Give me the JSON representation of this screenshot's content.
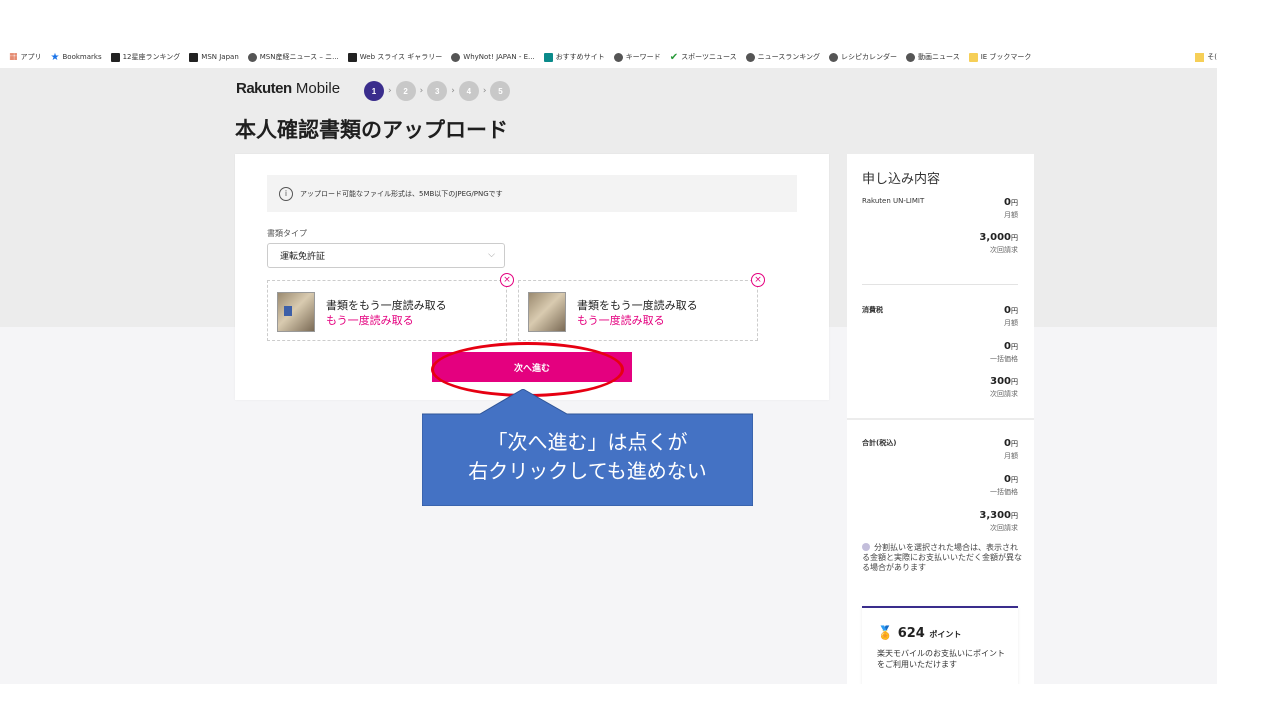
{
  "bookmarks": {
    "items": [
      {
        "label": "アプリ",
        "icon": "apps-icon"
      },
      {
        "label": "Bookmarks",
        "icon": "star-icon"
      },
      {
        "label": "12星座ランキング",
        "icon": "msn-icon"
      },
      {
        "label": "MSN Japan",
        "icon": "msn-icon"
      },
      {
        "label": "MSN産経ニュース – ニ...",
        "icon": "globe-icon"
      },
      {
        "label": "Web スライス ギャラリー",
        "icon": "msn-icon"
      },
      {
        "label": "WhyNot! JAPAN - E...",
        "icon": "globe-icon"
      },
      {
        "label": "おすすめサイト",
        "icon": "bing-icon"
      },
      {
        "label": "キーワード",
        "icon": "globe-icon"
      },
      {
        "label": "スポーツニュース",
        "icon": "sport-icon"
      },
      {
        "label": "ニュースランキング",
        "icon": "globe-icon"
      },
      {
        "label": "レシピカレンダー",
        "icon": "globe-icon"
      },
      {
        "label": "動画ニュース",
        "icon": "globe-icon"
      },
      {
        "label": "IE ブックマーク",
        "icon": "folder-icon"
      }
    ],
    "other": "そ("
  },
  "header": {
    "logo_bold": "Rakuten",
    "logo_rest": " Mobile",
    "steps": [
      "1",
      "2",
      "3",
      "4",
      "5"
    ],
    "active_step": 1,
    "title": "本人確認書類のアップロード"
  },
  "form": {
    "notice": "アップロード可能なファイル形式は、5MB以下のJPEG/PNGです",
    "doc_type_label": "書類タイプ",
    "doc_type_value": "運転免許証",
    "uploads": [
      {
        "title": "書類をもう一度読み取る",
        "link": "もう一度読み取る"
      },
      {
        "title": "書類をもう一度読み取る",
        "link": "もう一度読み取る"
      }
    ],
    "next_label": "次へ進む"
  },
  "summary": {
    "title": "申し込み内容",
    "plan": {
      "name": "Rakuten UN-LIMIT",
      "monthly": "0",
      "monthly_unit": "円",
      "monthly_label": "月額",
      "next": "3,000",
      "next_unit": "円",
      "next_label": "次回請求"
    },
    "tax": {
      "name": "消費税",
      "monthly": "0",
      "monthly_unit": "円",
      "monthly_label": "月額",
      "lump": "0",
      "lump_unit": "円",
      "lump_label": "一括価格",
      "next": "300",
      "next_unit": "円",
      "next_label": "次回請求"
    },
    "total": {
      "name": "合計(税込)",
      "monthly": "0",
      "monthly_unit": "円",
      "monthly_label": "月額",
      "lump": "0",
      "lump_unit": "円",
      "lump_label": "一括価格",
      "next": "3,300",
      "next_unit": "円",
      "next_label": "次回請求"
    },
    "note": "分割払いを選択された場合は、表示される金額と実際にお支払いいただく金額が異なる場合があります",
    "points": {
      "value": "624",
      "unit": "ポイント",
      "desc": "楽天モバイルのお支払いにポイントをご利用いただけます"
    }
  },
  "annotation": {
    "line1": "「次へ進む」は点くが",
    "line2": "右クリックしても進めない",
    "callout_color": "#4472c4",
    "ellipse_color": "#e60012"
  },
  "colors": {
    "accent": "#e4007f",
    "brand": "#3a2d8c"
  }
}
